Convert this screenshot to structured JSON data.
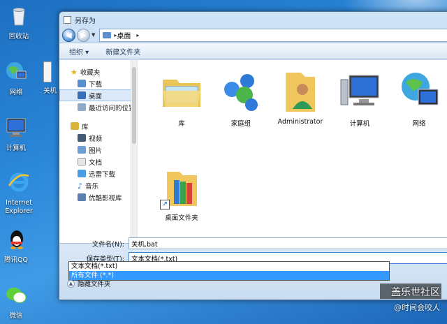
{
  "desktop": {
    "icons": [
      {
        "label": "回收站",
        "icon": "recycle-bin-icon"
      },
      {
        "label": "网络",
        "icon": "network-globe-icon"
      },
      {
        "label": "计算机",
        "icon": "computer-icon"
      },
      {
        "label": "Internet Explorer",
        "icon": "internet-explorer-icon"
      },
      {
        "label": "腾讯QQ",
        "icon": "qq-penguin-icon"
      },
      {
        "label": "微信",
        "icon": "wechat-icon"
      }
    ],
    "partial_icon_label": "关机"
  },
  "window": {
    "title": "另存为",
    "address": {
      "crumb": "桌面"
    },
    "toolbar": {
      "organize": "组织 ▾",
      "new_folder": "新建文件夹"
    },
    "nav": {
      "favorites_header": "收藏夹",
      "favorites": [
        {
          "label": "下载",
          "icon": "download-folder-icon"
        },
        {
          "label": "桌面",
          "icon": "desktop-folder-icon",
          "selected": true
        },
        {
          "label": "最近访问的位置",
          "icon": "recent-places-icon"
        }
      ],
      "library_header": "库",
      "libraries": [
        {
          "label": "视频",
          "icon": "video-library-icon"
        },
        {
          "label": "图片",
          "icon": "picture-library-icon"
        },
        {
          "label": "文档",
          "icon": "document-library-icon"
        },
        {
          "label": "迅雷下载",
          "icon": "thunder-download-icon"
        },
        {
          "label": "音乐",
          "icon": "music-library-icon"
        },
        {
          "label": "优酷影视库",
          "icon": "youku-library-icon"
        }
      ]
    },
    "files": [
      {
        "label": "库",
        "icon": "library-folder-icon"
      },
      {
        "label": "家庭组",
        "icon": "homegroup-icon"
      },
      {
        "label": "Administrator",
        "icon": "user-folder-icon"
      },
      {
        "label": "计算机",
        "icon": "computer-icon"
      },
      {
        "label": "网络",
        "icon": "network-icon"
      },
      {
        "label": "桌面文件夹",
        "icon": "folder-shortcut-icon"
      }
    ],
    "form": {
      "filename_label": "文件名(N):",
      "filename_value": "关机.bat",
      "filetype_label": "保存类型(T):",
      "filetype_value": "文本文档(*.txt)",
      "filetype_options": [
        "文本文档(*.txt)",
        "所有文件  (*.*)"
      ],
      "hide_folders": "隐藏文件夹"
    }
  },
  "watermark": {
    "brand": "盖乐世社区",
    "handle": "@时间会咬人"
  }
}
